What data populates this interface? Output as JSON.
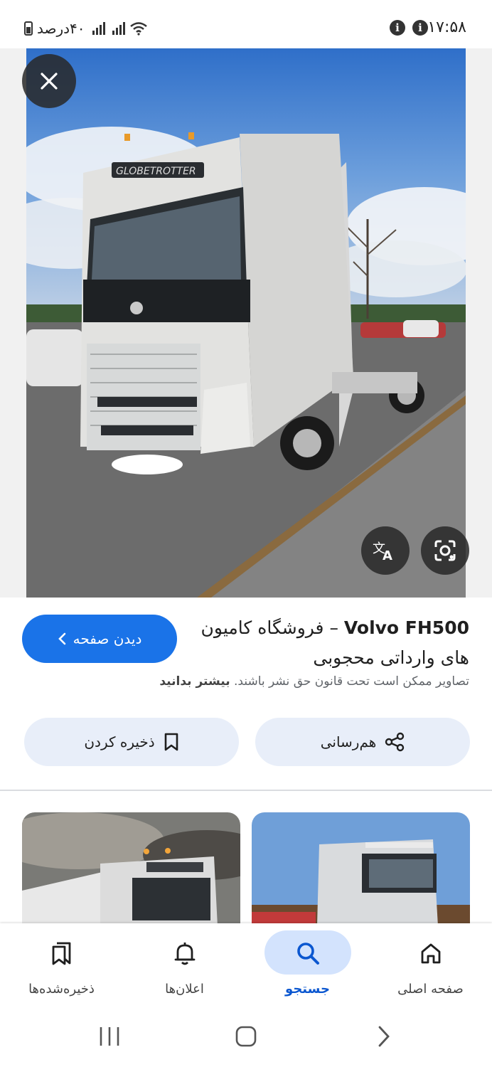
{
  "status_bar": {
    "time": "۱۷:۵۸",
    "battery_text": "۴۰درصد"
  },
  "image_viewer": {
    "hero_watermark": "GLOBETROTTER"
  },
  "result": {
    "title_latin": "Volvo FH500",
    "title_persian": " – فروشگاه کامیون های وارداتی محجوبی",
    "copyright_text": "تصاویر ممکن است تحت قانون حق نشر باشند. ",
    "learn_more": "بیشتر بدانید",
    "visit_button": "دیدن صفحه",
    "share_button": "هم‌رسانی",
    "save_button": "ذخیره کردن"
  },
  "bottom_nav": {
    "items": [
      {
        "label": "صفحه اصلی",
        "icon": "home-icon"
      },
      {
        "label": "جستجو",
        "icon": "search-icon"
      },
      {
        "label": "اعلان‌ها",
        "icon": "bell-icon"
      },
      {
        "label": "ذخیره‌شده‌ها",
        "icon": "bookmarks-icon"
      }
    ],
    "active_index": 1
  },
  "colors": {
    "accent": "#1a73e8",
    "pill_bg": "#e8eef9",
    "nav_active": "#d3e3fd"
  }
}
